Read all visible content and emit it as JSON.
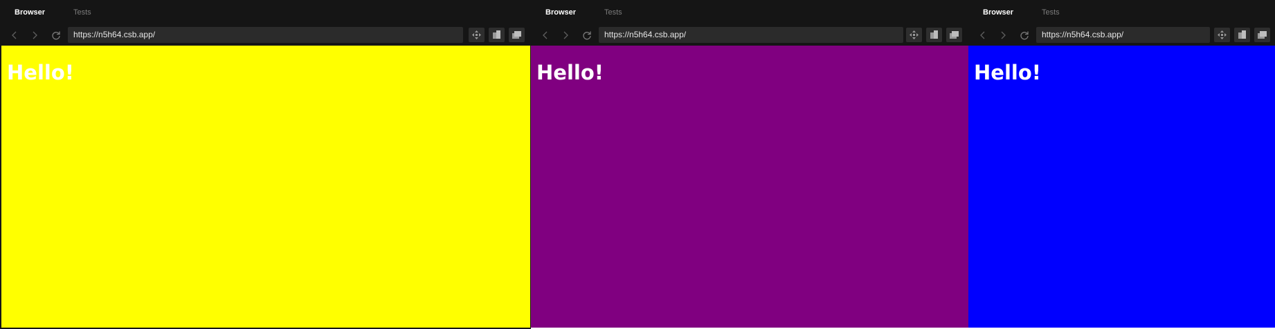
{
  "panels": [
    {
      "tabs": {
        "browser": "Browser",
        "tests": "Tests"
      },
      "url": "https://n5h64.csb.app/",
      "content": {
        "heading": "Hello!"
      },
      "background": "#ffff00"
    },
    {
      "tabs": {
        "browser": "Browser",
        "tests": "Tests"
      },
      "url": "https://n5h64.csb.app/",
      "content": {
        "heading": "Hello!"
      },
      "background": "#800080"
    },
    {
      "tabs": {
        "browser": "Browser",
        "tests": "Tests"
      },
      "url": "https://n5h64.csb.app/",
      "content": {
        "heading": "Hello!"
      },
      "background": "#0000ff"
    }
  ],
  "theme": {
    "chrome_bg": "#151515",
    "url_bar_bg": "#2b2b2b",
    "active_tab_color": "#ffffff",
    "inactive_tab_color": "#7d7d7d",
    "heading_color": "#ffffff"
  },
  "icons": {
    "back": "chevron-left-icon",
    "forward": "chevron-right-icon",
    "reload": "reload-icon",
    "tools": [
      "move-icon",
      "split-view-icon",
      "open-window-icon"
    ]
  }
}
